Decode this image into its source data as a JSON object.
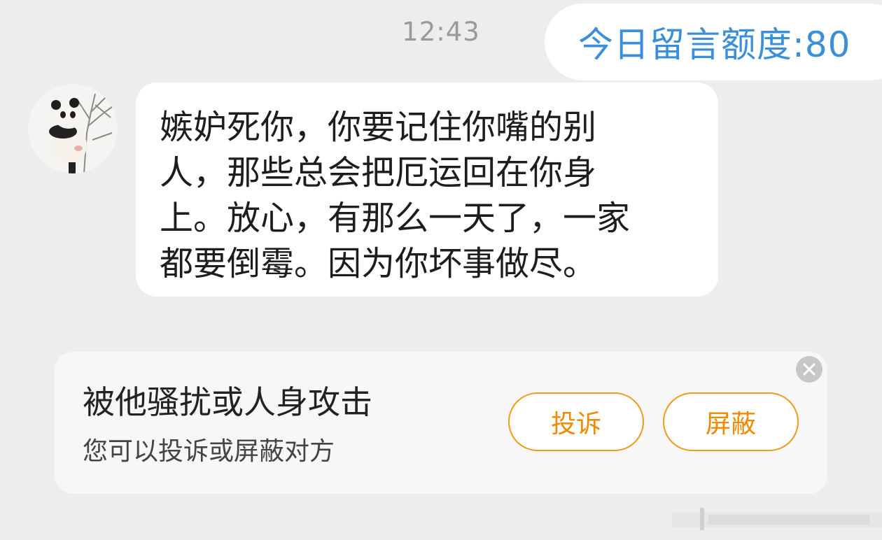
{
  "header": {
    "time": "12:43",
    "quota_text": "今日留言额度:80"
  },
  "message": {
    "avatar_icon": "panda-avatar-icon",
    "lines": [
      "嫉妒死你，你要记住你嘴的别",
      "人，那些总会把厄运回在你身",
      "上。放心，有那么一天了，一家",
      "都要倒霉。因为你坏事做尽。"
    ]
  },
  "harassment_card": {
    "title": "被他骚扰或人身攻击",
    "subtitle": "您可以投诉或屏蔽对方",
    "report_label": "投诉",
    "block_label": "屏蔽",
    "close_icon": "close-icon"
  },
  "colors": {
    "background": "#ededed",
    "quota_blue": "#3b8fd8",
    "accent_orange": "#ec8a00",
    "bubble": "#ffffff",
    "card": "#f7f7f7"
  }
}
